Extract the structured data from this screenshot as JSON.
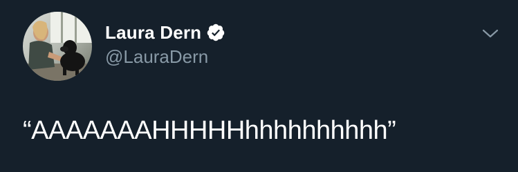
{
  "tweet": {
    "author": {
      "display_name": "Laura Dern",
      "handle": "@LauraDern",
      "verified": true
    },
    "text": "“AAAAAAAHHHHHhhhhhhhhhh”"
  },
  "icons": {
    "verified": "verified-badge-icon",
    "menu": "chevron-down-icon"
  },
  "colors": {
    "background": "#15202b",
    "primary_text": "#ffffff",
    "secondary_text": "#8899a6"
  }
}
